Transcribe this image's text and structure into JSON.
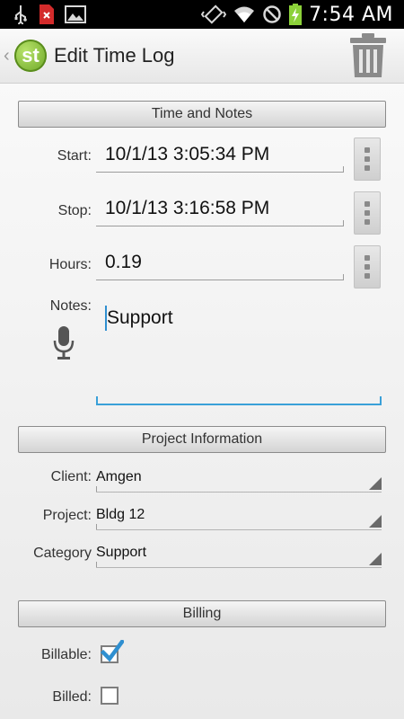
{
  "status_bar": {
    "time": "7:54 AM"
  },
  "action_bar": {
    "title": "Edit Time Log",
    "logo_text": "st"
  },
  "sections": {
    "time_notes": "Time and Notes",
    "project_info": "Project Information",
    "billing": "Billing"
  },
  "fields": {
    "start_label": "Start:",
    "start_value": "10/1/13 3:05:34 PM",
    "stop_label": "Stop:",
    "stop_value": "10/1/13 3:16:58 PM",
    "hours_label": "Hours:",
    "hours_value": "0.19",
    "notes_label": "Notes:",
    "notes_value": "Support"
  },
  "project": {
    "client_label": "Client:",
    "client_value": "Amgen",
    "project_label": "Project:",
    "project_value": "Bldg 12",
    "category_label": "Category",
    "category_value": "Support"
  },
  "billing": {
    "billable_label": "Billable:",
    "billable_checked": true,
    "billed_label": "Billed:",
    "billed_checked": false
  },
  "colors": {
    "accent": "#3aa0d8",
    "logo": "#7db52d",
    "battery": "#8cd13a"
  },
  "icons": [
    "usb-icon",
    "error-notification-icon",
    "image-icon",
    "vibrate-icon",
    "wifi-icon",
    "do-not-disturb-icon",
    "battery-charging-icon",
    "trash-icon",
    "microphone-icon",
    "overflow-menu-icon",
    "dropdown-arrow-icon",
    "checkmark-icon"
  ]
}
